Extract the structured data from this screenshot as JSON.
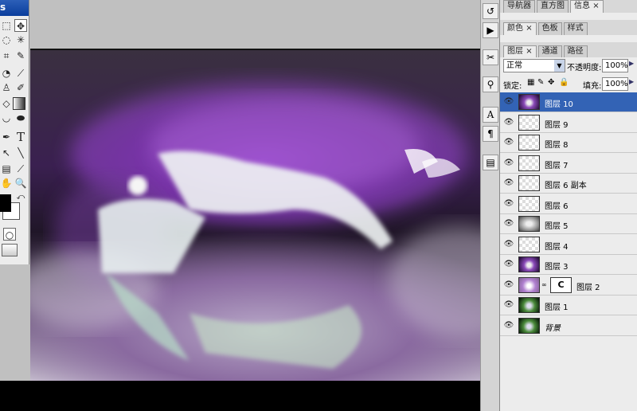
{
  "toolbox": {
    "title": "s"
  },
  "panels": {
    "top_tabs": [
      "导航器",
      "直方图",
      "信息"
    ],
    "color_tabs": [
      "颜色",
      "色板",
      "样式"
    ],
    "layer_tabs": [
      "图层",
      "通道",
      "路径"
    ],
    "blend_mode": "正常",
    "opacity_label": "不透明度:",
    "opacity_value": "100%",
    "lock_label": "锁定:",
    "fill_label": "填充:",
    "fill_value": "100%"
  },
  "layers": [
    {
      "name": "图层 10",
      "selected": true,
      "thumb": "purple"
    },
    {
      "name": "图层 9",
      "thumb": "empty"
    },
    {
      "name": "图层 8",
      "thumb": "empty"
    },
    {
      "name": "图层 7",
      "thumb": "empty"
    },
    {
      "name": "图层 6 副本",
      "thumb": "empty"
    },
    {
      "name": "图层 6",
      "thumb": "empty"
    },
    {
      "name": "图层 5",
      "thumb": "gray"
    },
    {
      "name": "图层 4",
      "thumb": "empty"
    },
    {
      "name": "图层 3",
      "thumb": "purple"
    },
    {
      "name": "图层 2",
      "thumb": "purple-mask"
    },
    {
      "name": "图层 1",
      "thumb": "green"
    },
    {
      "name": "背景",
      "thumb": "green"
    }
  ]
}
